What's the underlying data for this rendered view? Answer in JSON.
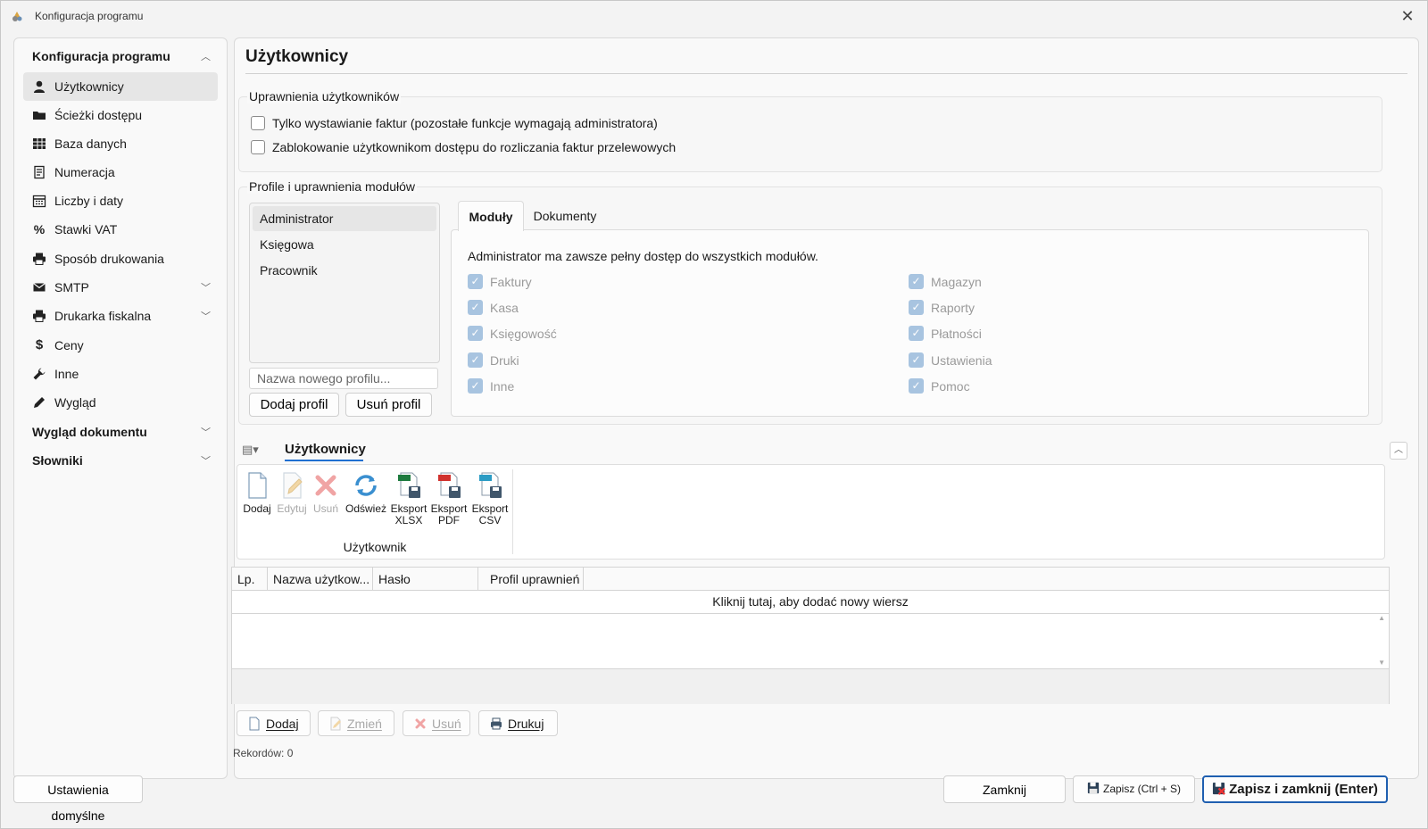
{
  "window": {
    "title": "Konfiguracja programu"
  },
  "sidebar": {
    "groups": [
      {
        "label": "Konfiguracja programu"
      },
      {
        "label": "Wygląd dokumentu"
      },
      {
        "label": "Słowniki"
      }
    ],
    "items": [
      {
        "label": "Użytkownicy",
        "icon": "user-icon"
      },
      {
        "label": "Ścieżki dostępu",
        "icon": "folder-icon"
      },
      {
        "label": "Baza danych",
        "icon": "table-icon"
      },
      {
        "label": "Numeracja",
        "icon": "document-icon"
      },
      {
        "label": "Liczby i daty",
        "icon": "calendar-icon"
      },
      {
        "label": "Stawki VAT",
        "icon": "percent-icon"
      },
      {
        "label": "Sposób drukowania",
        "icon": "printer-icon"
      },
      {
        "label": "SMTP",
        "icon": "mail-icon"
      },
      {
        "label": "Drukarka fiskalna",
        "icon": "printer-icon"
      },
      {
        "label": "Ceny",
        "icon": "dollar-icon"
      },
      {
        "label": "Inne",
        "icon": "wrench-icon"
      },
      {
        "label": "Wygląd",
        "icon": "pencil-icon"
      }
    ]
  },
  "main": {
    "title": "Użytkownicy",
    "permissions": {
      "title": "Uprawnienia użytkowników",
      "options": [
        "Tylko wystawianie faktur (pozostałe funkcje wymagają administratora)",
        "Zablokowanie użytkownikom dostępu do rozliczania faktur przelewowych"
      ]
    },
    "profiles": {
      "title": "Profile i uprawnienia modułów",
      "list": [
        "Administrator",
        "Księgowa",
        "Pracownik"
      ],
      "new_placeholder": "Nazwa nowego profilu...",
      "add_label": "Dodaj profil",
      "remove_label": "Usuń profil",
      "tabs": [
        "Moduły",
        "Dokumenty"
      ],
      "info": "Administrator ma zawsze pełny dostęp do wszystkich modułów.",
      "modules_left": [
        "Faktury",
        "Kasa",
        "Księgowość",
        "Druki",
        "Inne"
      ],
      "modules_right": [
        "Magazyn",
        "Raporty",
        "Płatności",
        "Ustawienia",
        "Pomoc"
      ]
    },
    "users": {
      "title": "Użytkownicy",
      "ribbon": {
        "buttons": [
          {
            "label": "Dodaj",
            "icon": "new-document-icon"
          },
          {
            "label": "Edytuj",
            "icon": "edit-icon"
          },
          {
            "label": "Usuń",
            "icon": "delete-icon"
          },
          {
            "label": "Odśwież",
            "icon": "refresh-icon"
          },
          {
            "label": "Eksport XLSX",
            "icon": "export-xlsx-icon"
          },
          {
            "label": "Eksport PDF",
            "icon": "export-pdf-icon"
          },
          {
            "label": "Eksport CSV",
            "icon": "export-csv-icon"
          }
        ],
        "group_label": "Użytkownik"
      },
      "grid": {
        "columns": [
          "Lp.",
          "Nazwa użytkow...",
          "Hasło",
          "Profil uprawnień"
        ],
        "add_row": "Kliknij tutaj, aby dodać nowy wiersz"
      },
      "nav": [
        "Dodaj",
        "Zmień",
        "Usuń",
        "Drukuj"
      ],
      "records": "Rekordów: 0"
    }
  },
  "footer": {
    "defaults": "Ustawienia domyślne",
    "close": "Zamknij",
    "save": "Zapisz (Ctrl + S)",
    "save_close": "Zapisz i zamknij (Enter)"
  },
  "colors": {
    "accent": "#1f6fd1",
    "checkbox_disabled": "#a8c4e0"
  }
}
